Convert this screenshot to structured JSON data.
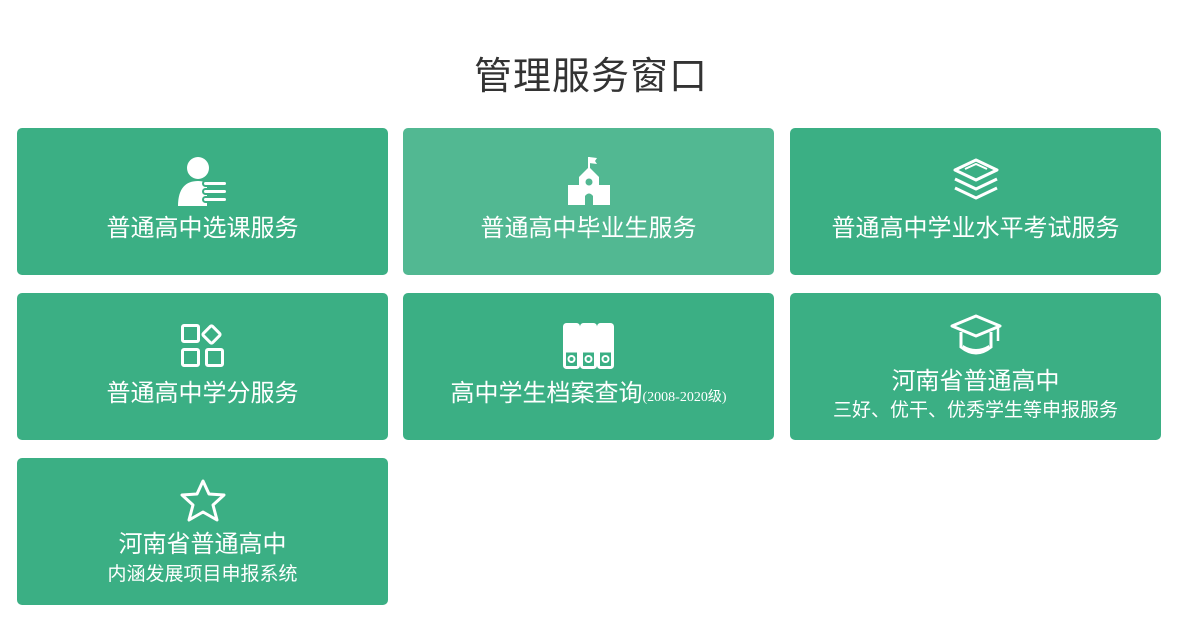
{
  "page": {
    "title": "管理服务窗口",
    "accent_color": "#3baf84",
    "hover_color": "#52b892"
  },
  "tiles": [
    {
      "label": "普通高中选课服务",
      "icon": "user-list-icon"
    },
    {
      "label": "普通高中毕业生服务",
      "icon": "school-building-icon"
    },
    {
      "label": "普通高中学业水平考试服务",
      "icon": "layers-icon"
    },
    {
      "label": "普通高中学分服务",
      "icon": "apps-grid-icon"
    },
    {
      "label": "高中学生档案查询",
      "label_suffix": "(2008-2020级)",
      "icon": "archive-binders-icon"
    },
    {
      "label": "河南省普通高中",
      "sublabel": "三好、优干、优秀学生等申报服务",
      "icon": "graduation-cap-icon"
    },
    {
      "label": "河南省普通高中",
      "sublabel": "内涵发展项目申报系统",
      "icon": "star-outline-icon"
    }
  ]
}
